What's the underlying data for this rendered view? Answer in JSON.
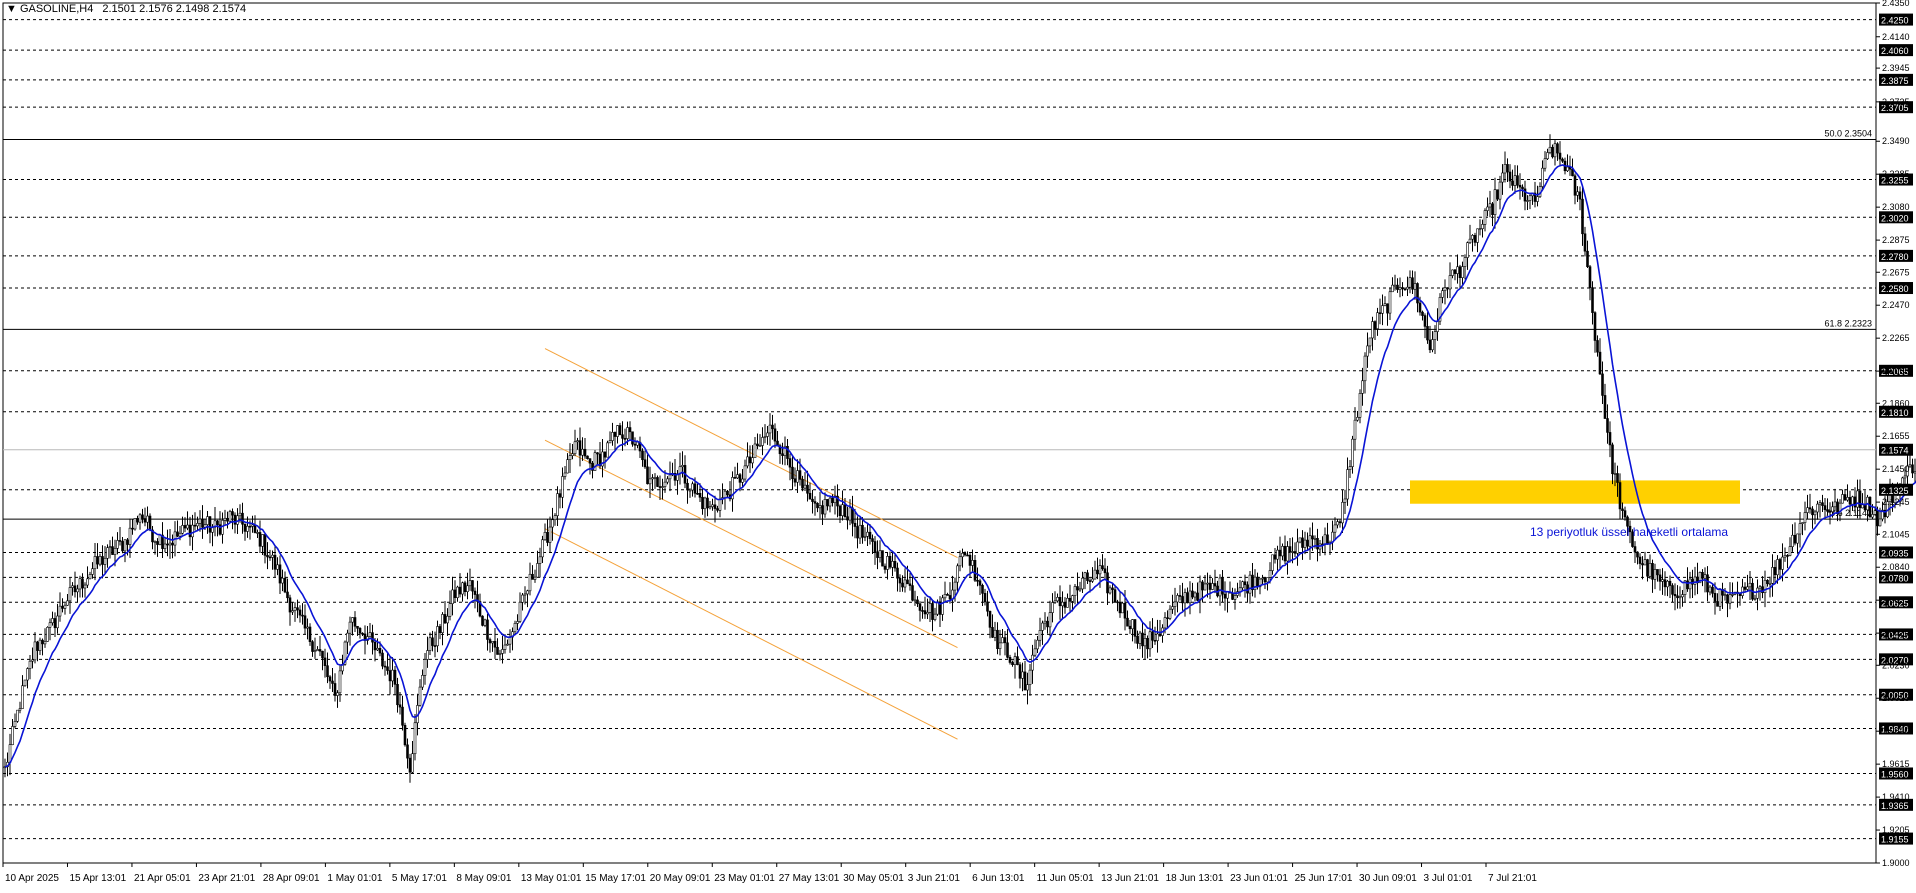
{
  "header": {
    "symbol": "GASOLINE,H4",
    "ohlc": "2.1501 2.1576 2.1498 2.1574"
  },
  "colors": {
    "background": "#ffffff",
    "candle": "#000000",
    "ema": "#0a14d6",
    "channel": "#f4a23a",
    "zone": "#ffd000",
    "annotation": "#0a14d6",
    "grid_dashed": "#000000"
  },
  "chart_data": {
    "type": "candlestick",
    "symbol": "GASOLINE",
    "timeframe": "H4",
    "ylim": [
      1.9,
      2.435
    ],
    "y_ticks": [
      2.435,
      2.414,
      2.3945,
      2.3735,
      2.349,
      2.3285,
      2.308,
      2.2875,
      2.2675,
      2.247,
      2.2265,
      2.206,
      2.186,
      2.1655,
      2.145,
      2.1245,
      2.1045,
      2.084,
      2.0635,
      2.043,
      2.023,
      2.0025,
      1.982,
      1.9615,
      1.941,
      1.9205,
      1.9
    ],
    "x_ticks": [
      "10 Apr 2025",
      "15 Apr 13:01",
      "21 Apr 05:01",
      "23 Apr 21:01",
      "28 Apr 09:01",
      "1 May 01:01",
      "5 May 17:01",
      "8 May 09:01",
      "13 May 01:01",
      "15 May 17:01",
      "20 May 09:01",
      "23 May 01:01",
      "27 May 13:01",
      "30 May 05:01",
      "3 Jun 21:01",
      "6 Jun 13:01",
      "11 Jun 05:01",
      "13 Jun 21:01",
      "18 Jun 13:01",
      "23 Jun 01:01",
      "25 Jun 17:01",
      "30 Jun 09:01",
      "3 Jul 01:01",
      "7 Jul 21:01"
    ],
    "dashed_levels": [
      2.425,
      2.406,
      2.3875,
      2.3705,
      2.3255,
      2.302,
      2.278,
      2.258,
      2.2065,
      2.181,
      2.1325,
      2.0935,
      2.078,
      2.0625,
      2.0425,
      2.027,
      2.005,
      1.984,
      1.956,
      1.9365,
      1.9155
    ],
    "fib_levels": [
      {
        "label": "50.0 2.3504",
        "value": 2.3504
      },
      {
        "label": "61.8 2.2323",
        "value": 2.2323
      },
      {
        "label": "73.6 2.1142",
        "value": 2.1142
      }
    ],
    "current_price": {
      "label": "2.1574",
      "value": 2.1574
    },
    "price_path": [
      [
        0,
        1.958
      ],
      [
        6,
        2.0
      ],
      [
        12,
        2.034
      ],
      [
        18,
        2.045
      ],
      [
        24,
        2.063
      ],
      [
        30,
        2.073
      ],
      [
        36,
        2.085
      ],
      [
        42,
        2.093
      ],
      [
        48,
        2.1
      ],
      [
        54,
        2.118
      ],
      [
        60,
        2.103
      ],
      [
        66,
        2.1
      ],
      [
        72,
        2.107
      ],
      [
        78,
        2.112
      ],
      [
        84,
        2.108
      ],
      [
        90,
        2.115
      ],
      [
        96,
        2.11
      ],
      [
        102,
        2.102
      ],
      [
        108,
        2.085
      ],
      [
        114,
        2.062
      ],
      [
        120,
        2.045
      ],
      [
        126,
        2.03
      ],
      [
        132,
        2.002
      ],
      [
        138,
        2.052
      ],
      [
        144,
        2.043
      ],
      [
        150,
        2.027
      ],
      [
        156,
        2.013
      ],
      [
        162,
        1.961
      ],
      [
        168,
        2.03
      ],
      [
        174,
        2.045
      ],
      [
        180,
        2.068
      ],
      [
        186,
        2.073
      ],
      [
        192,
        2.048
      ],
      [
        198,
        2.028
      ],
      [
        204,
        2.048
      ],
      [
        210,
        2.075
      ],
      [
        216,
        2.1
      ],
      [
        222,
        2.13
      ],
      [
        228,
        2.16
      ],
      [
        234,
        2.148
      ],
      [
        240,
        2.155
      ],
      [
        246,
        2.17
      ],
      [
        252,
        2.162
      ],
      [
        258,
        2.135
      ],
      [
        264,
        2.14
      ],
      [
        270,
        2.145
      ],
      [
        276,
        2.13
      ],
      [
        282,
        2.12
      ],
      [
        288,
        2.128
      ],
      [
        294,
        2.14
      ],
      [
        300,
        2.155
      ],
      [
        306,
        2.17
      ],
      [
        312,
        2.155
      ],
      [
        318,
        2.135
      ],
      [
        324,
        2.118
      ],
      [
        330,
        2.125
      ],
      [
        336,
        2.12
      ],
      [
        342,
        2.105
      ],
      [
        348,
        2.095
      ],
      [
        354,
        2.085
      ],
      [
        360,
        2.075
      ],
      [
        366,
        2.062
      ],
      [
        372,
        2.055
      ],
      [
        378,
        2.07
      ],
      [
        384,
        2.095
      ],
      [
        390,
        2.075
      ],
      [
        396,
        2.04
      ],
      [
        402,
        2.03
      ],
      [
        408,
        2.01
      ],
      [
        414,
        2.045
      ],
      [
        420,
        2.06
      ],
      [
        426,
        2.065
      ],
      [
        432,
        2.075
      ],
      [
        438,
        2.08
      ],
      [
        444,
        2.065
      ],
      [
        450,
        2.05
      ],
      [
        456,
        2.035
      ],
      [
        462,
        2.045
      ],
      [
        468,
        2.06
      ],
      [
        474,
        2.068
      ],
      [
        480,
        2.07
      ],
      [
        486,
        2.072
      ],
      [
        492,
        2.068
      ],
      [
        498,
        2.075
      ],
      [
        504,
        2.08
      ],
      [
        510,
        2.092
      ],
      [
        516,
        2.095
      ],
      [
        522,
        2.102
      ],
      [
        528,
        2.1
      ],
      [
        534,
        2.11
      ],
      [
        540,
        2.172
      ],
      [
        546,
        2.23
      ],
      [
        552,
        2.245
      ],
      [
        558,
        2.262
      ],
      [
        564,
        2.258
      ],
      [
        570,
        2.22
      ],
      [
        576,
        2.26
      ],
      [
        582,
        2.27
      ],
      [
        588,
        2.29
      ],
      [
        594,
        2.305
      ],
      [
        600,
        2.33
      ],
      [
        606,
        2.318
      ],
      [
        612,
        2.31
      ],
      [
        618,
        2.345
      ],
      [
        624,
        2.335
      ],
      [
        630,
        2.31
      ],
      [
        636,
        2.23
      ],
      [
        642,
        2.155
      ],
      [
        648,
        2.11
      ],
      [
        654,
        2.088
      ],
      [
        660,
        2.078
      ],
      [
        666,
        2.068
      ],
      [
        672,
        2.072
      ],
      [
        678,
        2.078
      ],
      [
        684,
        2.066
      ],
      [
        690,
        2.062
      ],
      [
        696,
        2.068
      ],
      [
        702,
        2.072
      ],
      [
        708,
        2.082
      ],
      [
        714,
        2.098
      ],
      [
        720,
        2.118
      ],
      [
        726,
        2.123
      ],
      [
        732,
        2.12
      ],
      [
        738,
        2.128
      ],
      [
        744,
        2.125
      ],
      [
        750,
        2.113
      ],
      [
        756,
        2.132
      ],
      [
        762,
        2.145
      ],
      [
        768,
        2.157
      ]
    ],
    "series": [
      {
        "name": "13 periyotluk üssel hareketli ortalama",
        "style": "line",
        "color": "#0a14d6",
        "derived": "ema13_of_close"
      }
    ],
    "channel": {
      "upper": [
        [
          216,
          2.22
        ],
        [
          381,
          2.09
        ]
      ],
      "lower": [
        [
          216,
          2.108
        ],
        [
          381,
          1.977
        ]
      ],
      "mid": [
        [
          216,
          2.163
        ],
        [
          381,
          2.034
        ]
      ]
    },
    "zone": {
      "x": [
        562,
        694
      ],
      "y": [
        2.1235,
        2.138
      ]
    },
    "annotations": [
      {
        "text": "13 periyotluk üssel hareketli ortalama",
        "x": 610,
        "y": 2.1035
      }
    ]
  }
}
